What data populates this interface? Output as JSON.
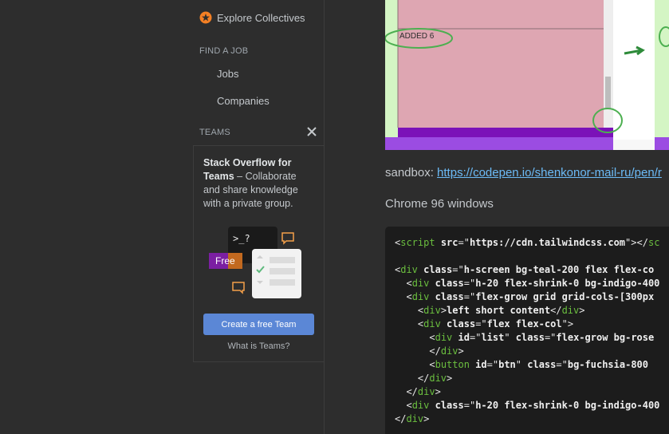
{
  "sidebar": {
    "explore_collectives": "Explore Collectives",
    "find_a_job_heading": "FIND A JOB",
    "jobs": "Jobs",
    "companies": "Companies",
    "teams_heading": "TEAMS",
    "teams_promo": {
      "title": "Stack Overflow for Teams",
      "dash": " – ",
      "body": "Collaborate and share knowledge with a private group.",
      "free_badge": "Free",
      "terminal_prompt": ">_?",
      "create_button": "Create a free Team",
      "what_is_teams": "What is Teams?"
    }
  },
  "main": {
    "screenshot_label": "ADDED 6",
    "sandbox_label": "sandbox: ",
    "sandbox_url": "https://codepen.io/shenkonor-mail-ru/pen/r",
    "chrome_line": "Chrome 96 windows",
    "code_lines": [
      "<script src=\"https://cdn.tailwindcss.com\"></sc",
      "",
      "<div class=\"h-screen bg-teal-200 flex flex-co",
      "  <div class=\"h-20 flex-shrink-0 bg-indigo-400",
      "  <div class=\"flex-grow grid grid-cols-[300px",
      "    <div>left short content</div>",
      "    <div class=\"flex flex-col\">",
      "      <div id=\"list\" class=\"flex-grow bg-rose",
      "      </div>",
      "      <button id=\"btn\" class=\"bg-fuchsia-800 ",
      "    </div>",
      "  </div>",
      "  <div class=\"h-20 flex-shrink-0 bg-indigo-400",
      "</div>"
    ]
  },
  "colors": {
    "accent_button": "#5b87d6",
    "link": "#6cbbf7",
    "collective_orange": "#f48024",
    "free_badge_purple": "#7b1fa2"
  }
}
